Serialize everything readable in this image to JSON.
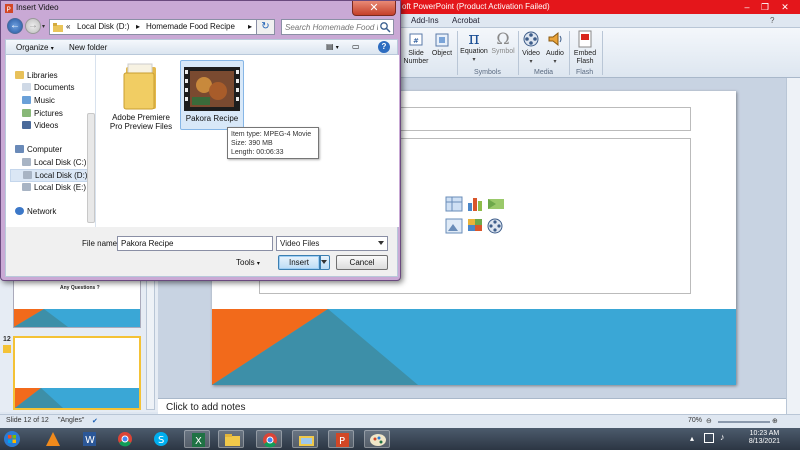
{
  "dialog": {
    "title": "Insert Video",
    "close_label": "✕",
    "breadcrumb": [
      "Local Disk (D:)",
      "Homemade Food Recipe"
    ],
    "search_placeholder": "Search Homemade Food Recipe",
    "toolbar": {
      "organize": "Organize",
      "new_folder": "New folder"
    },
    "nav": {
      "libraries": "Libraries",
      "documents": "Documents",
      "music": "Music",
      "pictures": "Pictures",
      "videos": "Videos",
      "computer": "Computer",
      "disk_c": "Local Disk (C:)",
      "disk_d": "Local Disk (D:)",
      "disk_e": "Local Disk (E:)",
      "network": "Network"
    },
    "files": [
      {
        "name_line1": "Adobe Premiere",
        "name_line2": "Pro Preview Files",
        "kind": "folder-icon"
      },
      {
        "name_line1": "Pakora Recipe",
        "name_line2": "",
        "kind": "video-icon"
      }
    ],
    "tooltip": {
      "type": "Item type: MPEG-4 Movie",
      "size": "Size: 390 MB",
      "length": "Length: 00:06:33"
    },
    "file_name_label": "File name:",
    "file_name_value": "Pakora Recipe",
    "file_type": "Video Files",
    "tools_label": "Tools",
    "insert_label": "Insert",
    "cancel_label": "Cancel"
  },
  "ppt": {
    "title": "oft PowerPoint (Product Activation Failed)",
    "tabs": [
      "Add-Ins",
      "Acrobat"
    ],
    "ribbon": {
      "slide_number_1": "Slide",
      "slide_number_2": "Number",
      "object": "Object",
      "equation": "Equation",
      "symbol": "Symbol",
      "video": "Video",
      "audio": "Audio",
      "embed_flash_1": "Embed",
      "embed_flash_2": "Flash",
      "group_symbols": "Symbols",
      "group_media": "Media",
      "group_flash": "Flash"
    },
    "thumb_text": "Any Questions ?",
    "slide_num": "12",
    "notes_placeholder": "Click to add notes",
    "status": {
      "slide": "Slide 12 of 12",
      "theme": "\"Angles\"",
      "zoom": "70%"
    },
    "clock": {
      "time": "10:23 AM",
      "date": "8/13/2021"
    }
  },
  "colors": {
    "slide_blue": "#3aa7d6",
    "slide_orange": "#f26a1b",
    "slide_teal": "#3d8fa8",
    "title_bar": "#e4161b",
    "dialog_frame": "#c9a9d5"
  }
}
